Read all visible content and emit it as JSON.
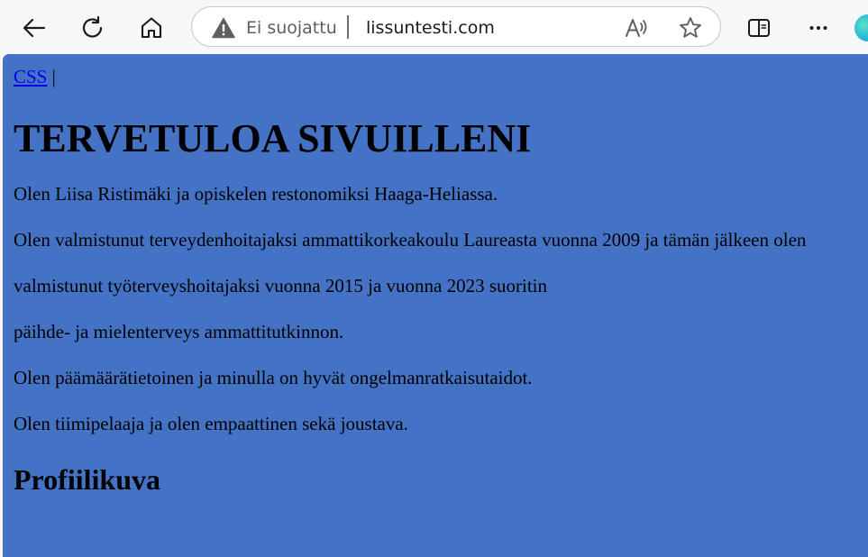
{
  "browser": {
    "address_bar": {
      "security_status": "Ei suojattu",
      "url": "lissuntesti.com"
    },
    "icons": {
      "back": "back-arrow-icon",
      "refresh": "refresh-icon",
      "home": "home-icon",
      "warning": "warning-icon",
      "read_aloud": "read-aloud-icon",
      "favorite": "star-icon",
      "split_screen": "split-screen-icon",
      "more": "more-icon"
    }
  },
  "page": {
    "background_color": "#4472c4",
    "nav": {
      "link_label": "CSS",
      "separator": "|"
    },
    "heading": "TERVETULOA SIVUILLENI",
    "paragraphs": [
      "Olen Liisa Ristimäki ja opiskelen restonomiksi Haaga-Heliassa.",
      "Olen valmistunut terveydenhoitajaksi ammattikorkeakoulu Laureasta vuonna 2009 ja tämän jälkeen olen",
      "valmistunut työterveyshoitajaksi vuonna 2015 ja vuonna 2023 suoritin",
      "päihde- ja mielenterveys ammattitutkinnon.",
      "Olen päämäärätietoinen ja minulla on hyvät ongelmanratkaisutaidot.",
      "Olen tiimipelaaja ja olen empaattinen sekä joustava."
    ],
    "subheading": "Profiilikuva"
  }
}
